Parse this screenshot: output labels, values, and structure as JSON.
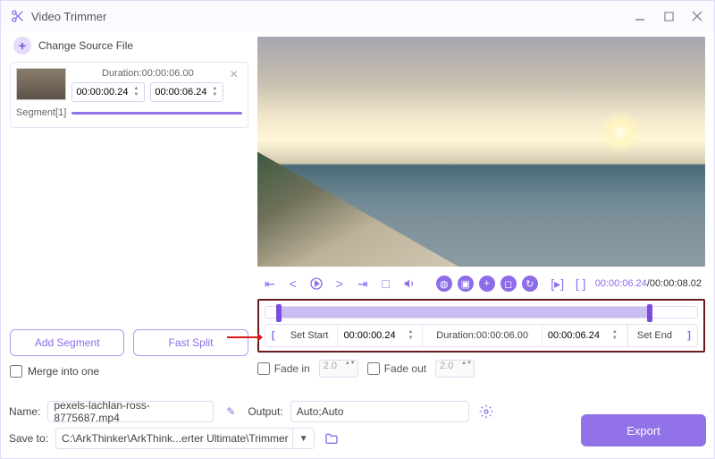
{
  "window": {
    "title": "Video Trimmer"
  },
  "source": {
    "change_label": "Change Source File"
  },
  "segment": {
    "duration_label": "Duration:00:00:06.00",
    "start": "00:00:00.24",
    "end": "00:00:06.24",
    "name": "Segment[1]"
  },
  "left_actions": {
    "add_segment": "Add Segment",
    "fast_split": "Fast Split",
    "merge": "Merge into one"
  },
  "player": {
    "current": "00:00:06.24",
    "total": "00:00:08.02"
  },
  "trim": {
    "set_start": "Set Start",
    "start_time": "00:00:00.24",
    "duration_label": "Duration:00:00:06.00",
    "end_time": "00:00:06.24",
    "set_end": "Set End"
  },
  "fade": {
    "in_label": "Fade in",
    "in_val": "2.0",
    "out_label": "Fade out",
    "out_val": "2.0"
  },
  "footer": {
    "name_label": "Name:",
    "name_value": "pexels-lachlan-ross-8775687.mp4",
    "output_label": "Output:",
    "output_value": "Auto;Auto",
    "save_label": "Save to:",
    "save_value": "C:\\ArkThinker\\ArkThink...erter Ultimate\\Trimmer",
    "export": "Export"
  }
}
